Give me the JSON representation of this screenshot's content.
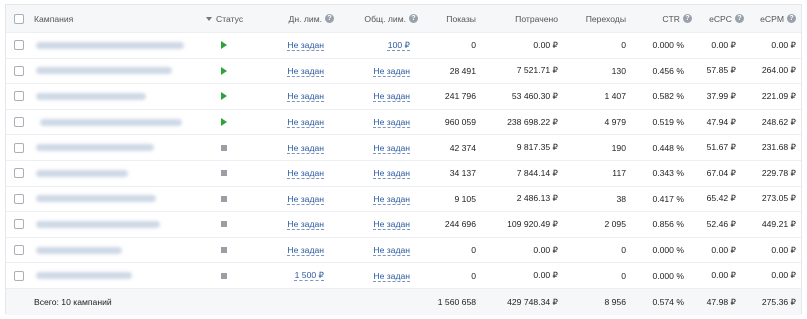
{
  "header": {
    "campaign": "Кампания",
    "status": "Статус",
    "daily_limit": "Дн. лим.",
    "total_limit": "Общ. лим.",
    "impressions": "Показы",
    "spent": "Потрачено",
    "clicks": "Переходы",
    "ctr": "CTR",
    "ecpc": "eCPC",
    "ecpm": "eCPM",
    "help_glyph": "?"
  },
  "rows": [
    {
      "status": "active",
      "daily": "Не задан",
      "total": "100 ₽",
      "impressions": "0",
      "spent": "0.00 ₽",
      "clicks": "0",
      "ctr": "0.000 %",
      "ecpc": "0.00 ₽",
      "ecpm": "0.00 ₽"
    },
    {
      "status": "active",
      "daily": "Не задан",
      "total": "Не задан",
      "impressions": "28 491",
      "spent": "7 521.71 ₽",
      "clicks": "130",
      "ctr": "0.456 %",
      "ecpc": "57.85 ₽",
      "ecpm": "264.00 ₽"
    },
    {
      "status": "active",
      "daily": "Не задан",
      "total": "Не задан",
      "impressions": "241 796",
      "spent": "53 460.30 ₽",
      "clicks": "1 407",
      "ctr": "0.582 %",
      "ecpc": "37.99 ₽",
      "ecpm": "221.09 ₽"
    },
    {
      "status": "active",
      "daily": "Не задан",
      "total": "Не задан",
      "impressions": "960 059",
      "spent": "238 698.22 ₽",
      "clicks": "4 979",
      "ctr": "0.519 %",
      "ecpc": "47.94 ₽",
      "ecpm": "248.62 ₽"
    },
    {
      "status": "stopped",
      "daily": "Не задан",
      "total": "Не задан",
      "impressions": "42 374",
      "spent": "9 817.35 ₽",
      "clicks": "190",
      "ctr": "0.448 %",
      "ecpc": "51.67 ₽",
      "ecpm": "231.68 ₽"
    },
    {
      "status": "stopped",
      "daily": "Не задан",
      "total": "Не задан",
      "impressions": "34 137",
      "spent": "7 844.14 ₽",
      "clicks": "117",
      "ctr": "0.343 %",
      "ecpc": "67.04 ₽",
      "ecpm": "229.78 ₽"
    },
    {
      "status": "stopped",
      "daily": "Не задан",
      "total": "Не задан",
      "impressions": "9 105",
      "spent": "2 486.13 ₽",
      "clicks": "38",
      "ctr": "0.417 %",
      "ecpc": "65.42 ₽",
      "ecpm": "273.05 ₽"
    },
    {
      "status": "stopped",
      "daily": "Не задан",
      "total": "Не задан",
      "impressions": "244 696",
      "spent": "109 920.49 ₽",
      "clicks": "2 095",
      "ctr": "0.856 %",
      "ecpc": "52.46 ₽",
      "ecpm": "449.21 ₽"
    },
    {
      "status": "stopped",
      "daily": "Не задан",
      "total": "Не задан",
      "impressions": "0",
      "spent": "0.00 ₽",
      "clicks": "0",
      "ctr": "0.000 %",
      "ecpc": "0.00 ₽",
      "ecpm": "0.00 ₽"
    },
    {
      "status": "stopped",
      "daily": "1 500 ₽",
      "total": "Не задан",
      "impressions": "0",
      "spent": "0.00 ₽",
      "clicks": "0",
      "ctr": "0.000 %",
      "ecpc": "0.00 ₽",
      "ecpm": "0.00 ₽"
    }
  ],
  "totals": {
    "label": "Всего: 10 кампаний",
    "impressions": "1 560 658",
    "spent": "429 748.34 ₽",
    "clicks": "8 956",
    "ctr": "0.574 %",
    "ecpc": "47.98 ₽",
    "ecpm": "275.36 ₽"
  },
  "colors": {
    "active": "#2fa33b",
    "stopped": "#9a9ea5",
    "link": "#2c5aa0"
  }
}
